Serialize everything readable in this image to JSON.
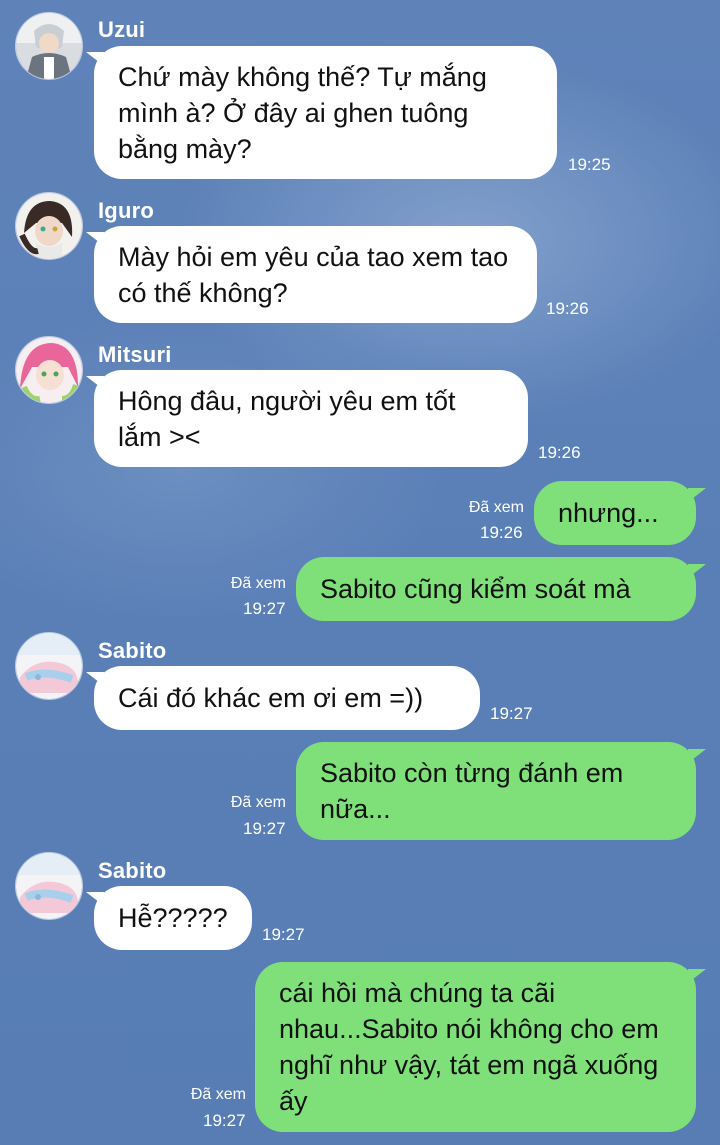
{
  "messages": [
    {
      "sender": "Uzui",
      "text": "Chứ mày không thế? Tự mắng mình à? Ở đây ai ghen tuông bằng mày?",
      "time": "19:25"
    },
    {
      "sender": "Iguro",
      "text": "Mày hỏi em yêu của tao xem tao có thế không?",
      "time": "19:26"
    },
    {
      "sender": "Mitsuri",
      "text": "Hông đâu, người yêu em tốt lắm ><",
      "time": "19:26"
    },
    {
      "text": "nhưng...",
      "read": "Đã xem",
      "time": "19:26"
    },
    {
      "text": "Sabito cũng kiểm soát mà",
      "read": "Đã xem",
      "time": "19:27"
    },
    {
      "sender": "Sabito",
      "text": "Cái đó khác em ơi em =))",
      "time": "19:27"
    },
    {
      "text": "Sabito còn từng đánh em nữa...",
      "read": "Đã xem",
      "time": "19:27"
    },
    {
      "sender": "Sabito",
      "text": "Hễ?????",
      "time": "19:27"
    },
    {
      "text": "cái hồi mà chúng ta cãi nhau...Sabito nói không cho em nghĩ như vậy, tát em ngã xuống ấy",
      "read": "Đã xem",
      "time": "19:27"
    }
  ],
  "avatars": {
    "uzui": "uzui-avatar",
    "iguro": "iguro-avatar",
    "mitsuri": "mitsuri-avatar",
    "sabito": "sabito-avatar"
  },
  "colors": {
    "background": "#5b7fb6",
    "incoming_bubble": "#ffffff",
    "outgoing_bubble": "#7fe07a"
  }
}
